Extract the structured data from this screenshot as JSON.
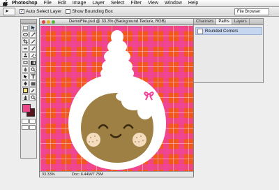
{
  "menubar": {
    "apple_icon": "apple-logo",
    "items": [
      "Photoshop",
      "File",
      "Edit",
      "Image",
      "Layer",
      "Select",
      "Filter",
      "View",
      "Window",
      "Help"
    ]
  },
  "options_bar": {
    "auto_select_label": "Auto Select Layer",
    "auto_select_checked": true,
    "show_bounding_label": "Show Bounding Box",
    "show_bounding_checked": false,
    "file_browser_label": "File Browser"
  },
  "toolbox": {
    "foreground_color": "#f0448a",
    "background_color": "#57141a",
    "tools": [
      "move",
      "marquee",
      "lasso",
      "magic-wand",
      "crop",
      "slice",
      "healing",
      "brush",
      "stamp",
      "history-brush",
      "eraser",
      "gradient",
      "blur",
      "dodge",
      "path-select",
      "type",
      "pen",
      "shape",
      "notes",
      "eyedropper",
      "hand",
      "zoom"
    ]
  },
  "document": {
    "title": "DemoFile.psd @ 33.3% (Background Texture, RGB)",
    "zoom": "33.33%",
    "doc_size": "Doc: 6.44M/7.75M",
    "colors": {
      "plaid_bg": "#f3571d",
      "plaid_stripe": "#f0449a",
      "face": "#9f8044",
      "cheeks": "#f4ddbf",
      "bow": "#f0449a"
    }
  },
  "paths_panel": {
    "tabs": [
      "Channels",
      "Paths",
      "Layers"
    ],
    "active_tab": "Paths",
    "items": [
      "Rounded Corners"
    ]
  }
}
